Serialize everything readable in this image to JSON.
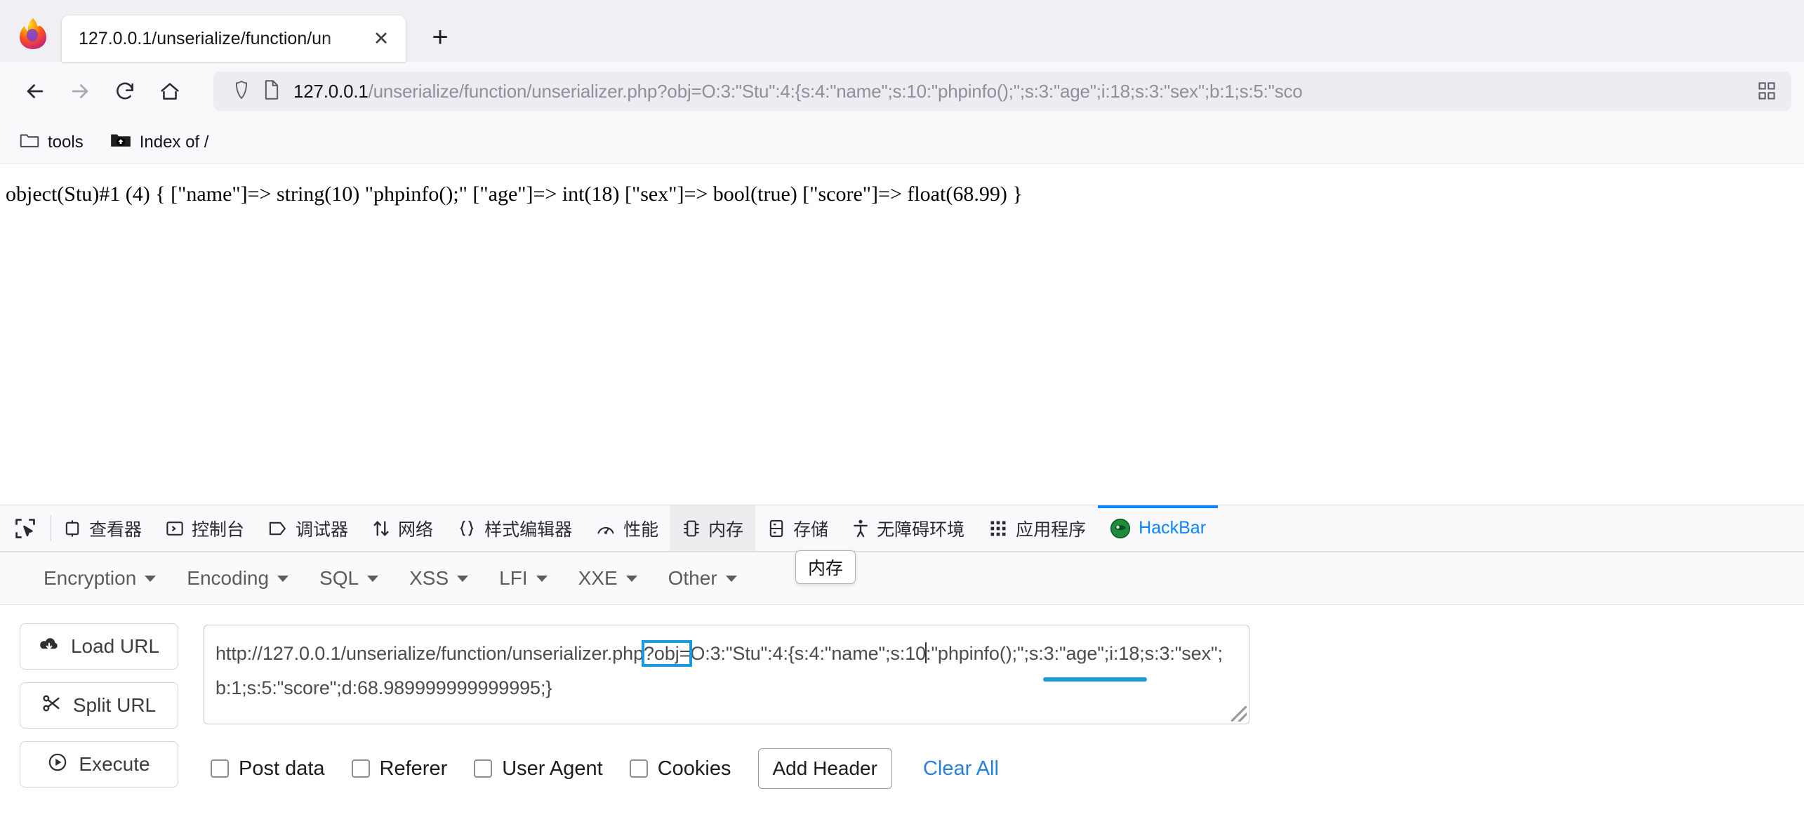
{
  "browser": {
    "tab": {
      "title": "127.0.0.1/unserialize/function/un",
      "close_label": "✕"
    },
    "new_tab_label": "+",
    "nav": {
      "back_icon": "back-arrow-icon",
      "forward_icon": "forward-arrow-icon",
      "reload_icon": "reload-icon",
      "home_icon": "home-icon"
    },
    "urlbar": {
      "host": "127.0.0.1",
      "path": "/unserialize/function/unserializer.php?obj=O:3:\"Stu\":4:{s:4:\"name\";s:10:\"phpinfo();\";s:3:\"age\";i:18;s:3:\"sex\";b:1;s:5:\"sco",
      "shield_icon": "shield-icon",
      "page_icon": "page-document-icon",
      "right_icon": "qr-reader-icon"
    },
    "bookmarks": [
      {
        "label": "tools",
        "icon": "folder-icon"
      },
      {
        "label": "Index of /",
        "icon": "dark-folder-upload-icon"
      }
    ]
  },
  "page": {
    "output": "object(Stu)#1 (4) { [\"name\"]=> string(10) \"phpinfo();\" [\"age\"]=> int(18) [\"sex\"]=> bool(true) [\"score\"]=> float(68.99) }"
  },
  "devtools": {
    "picker_icon": "element-picker-icon",
    "tooltip": "内存",
    "accent_color": "#0a84ff",
    "tabs": [
      {
        "label": "查看器",
        "icon": "inspector-icon",
        "state": "normal"
      },
      {
        "label": "控制台",
        "icon": "console-icon",
        "state": "normal"
      },
      {
        "label": "调试器",
        "icon": "debugger-icon",
        "state": "normal"
      },
      {
        "label": "网络",
        "icon": "network-icon",
        "state": "normal"
      },
      {
        "label": "样式编辑器",
        "icon": "style-editor-icon",
        "state": "normal"
      },
      {
        "label": "性能",
        "icon": "performance-icon",
        "state": "normal"
      },
      {
        "label": "内存",
        "icon": "memory-icon",
        "state": "hovered"
      },
      {
        "label": "存储",
        "icon": "storage-icon",
        "state": "normal"
      },
      {
        "label": "无障碍环境",
        "icon": "accessibility-icon",
        "state": "normal"
      },
      {
        "label": "应用程序",
        "icon": "application-icon",
        "state": "normal"
      },
      {
        "label": "HackBar",
        "icon": "hackbar-logo-icon",
        "state": "active"
      }
    ]
  },
  "hackbar": {
    "menus": [
      {
        "label": "Encryption"
      },
      {
        "label": "Encoding"
      },
      {
        "label": "SQL"
      },
      {
        "label": "XSS"
      },
      {
        "label": "LFI"
      },
      {
        "label": "XXE"
      },
      {
        "label": "Other"
      }
    ],
    "actions": [
      {
        "label": "Load URL",
        "icon": "cloud-download-icon"
      },
      {
        "label": "Split URL",
        "icon": "scissors-icon"
      },
      {
        "label": "Execute",
        "icon": "play-circle-icon"
      }
    ],
    "url_field": {
      "prefix": "http://127.0.0.1/unserialize/function/unserializer.php",
      "highlight": "?obj=",
      "after_highlight": "O:3:\"Stu\":4:{s:4:\"name\";s:10",
      "tail": ":\"phpinfo();\";s:3:\"age\";i:18;s:3:\"sex\";b:1;s:5:\"score\";d:68.989999999999995;}",
      "full_value": "http://127.0.0.1/unserialize/function/unserializer.php?obj=O:3:\"Stu\":4:{s:4:\"name\";s:10:\"phpinfo();\";s:3:\"age\";i:18;s:3:\"sex\";b:1;s:5:\"score\";d:68.989999999999995;}",
      "highlight_color": "#1a9bdc"
    },
    "options": [
      {
        "label": "Post data",
        "checked": false
      },
      {
        "label": "Referer",
        "checked": false
      },
      {
        "label": "User Agent",
        "checked": false
      },
      {
        "label": "Cookies",
        "checked": false
      }
    ],
    "add_header_label": "Add Header",
    "clear_all_label": "Clear All"
  }
}
